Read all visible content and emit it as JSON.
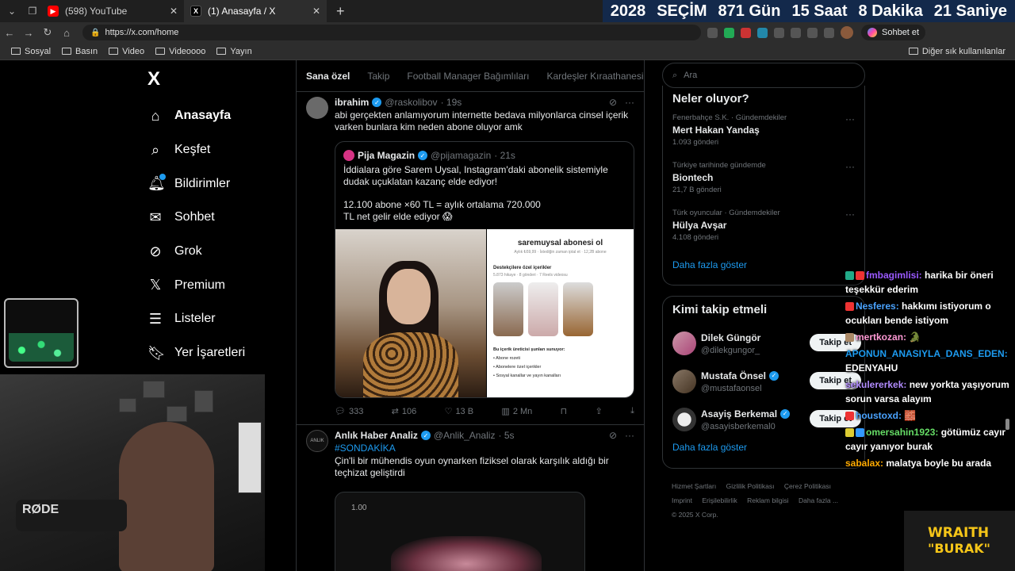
{
  "browser": {
    "tabs": [
      {
        "label": "(598) YouTube",
        "icon": "youtube-icon",
        "active": false
      },
      {
        "label": "(1) Anasayfa / X",
        "icon": "x-icon",
        "active": true
      }
    ],
    "url": "https://x.com/home",
    "chat_button": "Sohbet et",
    "bookmarks": [
      "Sosyal",
      "Basın",
      "Video",
      "Videoooo",
      "Yayın"
    ],
    "other_favorites": "Diğer sık kullanılanlar"
  },
  "countdown": {
    "year": "2028",
    "label": "SEÇİM",
    "days": "871 Gün",
    "hours": "15 Saat",
    "minutes": "8 Dakika",
    "seconds": "21 Saniye",
    "color": "#13294b"
  },
  "x_nav": {
    "logo": "X",
    "items": [
      {
        "label": "Anasayfa",
        "icon": "home-icon"
      },
      {
        "label": "Keşfet",
        "icon": "search-icon"
      },
      {
        "label": "Bildirimler",
        "icon": "bell-icon"
      },
      {
        "label": "Sohbet",
        "icon": "mail-icon"
      },
      {
        "label": "Grok",
        "icon": "grok-icon"
      },
      {
        "label": "Premium",
        "icon": "x-icon"
      },
      {
        "label": "Listeler",
        "icon": "list-icon"
      },
      {
        "label": "Yer İşaretleri",
        "icon": "bookmark-icon"
      }
    ]
  },
  "feed": {
    "tabs": [
      "Sana özel",
      "Takip",
      "Football Manager Bağımlıları",
      "Kardeşler Kıraathanesi"
    ],
    "tweet1": {
      "name": "ibrahim",
      "handle": "@raskolibov",
      "time": "· 19s",
      "text": "abi gerçekten anlamıyorum internette bedava milyonlarca cinsel içerik varken bunlara kim neden abone oluyor amk",
      "quote": {
        "name": "Pija Magazin",
        "handle": "@pijamagazin",
        "time": "· 21s",
        "line1": "İddialara göre Sarem Uysal, Instagram'daki abonelik sistemiyle dudak uçuklatan kazanç elde ediyor!",
        "line2": "12.100 abone ×60  TL = aylık ortalama 720.000",
        "line3": " TL net gelir elde ediyor 😱",
        "shot_title": "saremuysal abonesi ol",
        "shot_sub": "Aylık ₺59,99 · İstediğin zaman iptal et · 12,2B abone",
        "shot_section": "Destekçilere özel içerikler",
        "shot_counts": "5.873 hikaye · 8 gönderi · 7 Reels videosu",
        "shot_list_title": "Bu içerik üreticisi şunları sunuyor:",
        "shot_list": [
          "Abone rozeti",
          "Abonelere özel içerikler",
          "Sosyal kanallar ve yayın kanalları"
        ]
      },
      "replies": "333",
      "reposts": "106",
      "likes": "13 B",
      "views": "2 Mn"
    },
    "tweet2": {
      "avatar_text": "ANLIK",
      "name": "Anlık Haber Analiz",
      "handle": "@Anlik_Analiz",
      "time": "· 5s",
      "hashtag": "#SONDAKİKA",
      "text": "Çin'li bir mühendis oyun oynarken fiziksel olarak karşılık aldığı bir teçhizat geliştirdi",
      "media_value": "1.00"
    }
  },
  "sidebar": {
    "search_placeholder": "Ara",
    "trends_title": "Neler oluyor?",
    "trends": [
      {
        "context": "Fenerbahçe S.K. · Gündemdekiler",
        "name": "Mert Hakan Yandaş",
        "count": "1.093 gönderi"
      },
      {
        "context": "Türkiye tarihinde gündemde",
        "name": "Biontech",
        "count": "21,7 B gönderi"
      },
      {
        "context": "Türk oyuncular · Gündemdekiler",
        "name": "Hülya Avşar",
        "count": "4.108 gönderi"
      }
    ],
    "show_more": "Daha fazla göster",
    "who_title": "Kimi takip etmeli",
    "who": [
      {
        "name": "Dilek Güngör",
        "handle": "@dilekgungor_",
        "verified": false
      },
      {
        "name": "Mustafa Önsel",
        "handle": "@mustafaonsel",
        "verified": true
      },
      {
        "name": "Asayiş Berkemal",
        "handle": "@asayisberkemal0",
        "verified": true
      }
    ],
    "follow_label": "Takip et",
    "footer": [
      "Hizmet Şartları",
      "Gizlilik Politikası",
      "Çerez Politikası",
      "Imprint",
      "Erişilebilirlik",
      "Reklam bilgisi",
      "Daha fazla ...",
      "© 2025 X Corp."
    ]
  },
  "chat": [
    {
      "user": "fmbagimlisi:",
      "text": " harika bir öneri teşekkür ederim",
      "color": "#9b59ff"
    },
    {
      "user": "Nesferes:",
      "text": " hakkımı istiyorum o ocukları bende istiyom",
      "color": "#4aa3ff"
    },
    {
      "user": "mertkozan:",
      "text": " 🐊",
      "color": "#ff9ad5"
    },
    {
      "user": "APONUN_ANASIYLA_DANS_EDEN:",
      "text": " EDENYAHU",
      "color": "#1d9bf0"
    },
    {
      "user": "sekulererkek:",
      "text": " new yorkta yaşıyorum sorun varsa alayım",
      "color": "#b28cff"
    },
    {
      "user": "houstoxd:",
      "text": " 🧱",
      "color": "#4aa3ff"
    },
    {
      "user": "omersahin1923:",
      "text": " götümüz cayır cayır yanıyor burak",
      "color": "#66dd66"
    },
    {
      "user": "sabalax:",
      "text": " malatya boyle bu arada",
      "color": "#ffaa00"
    }
  ],
  "brand": {
    "line1": "WRAITH",
    "line2": "\"BURAK\""
  },
  "webcam": {
    "mic_label": "RØDE"
  }
}
